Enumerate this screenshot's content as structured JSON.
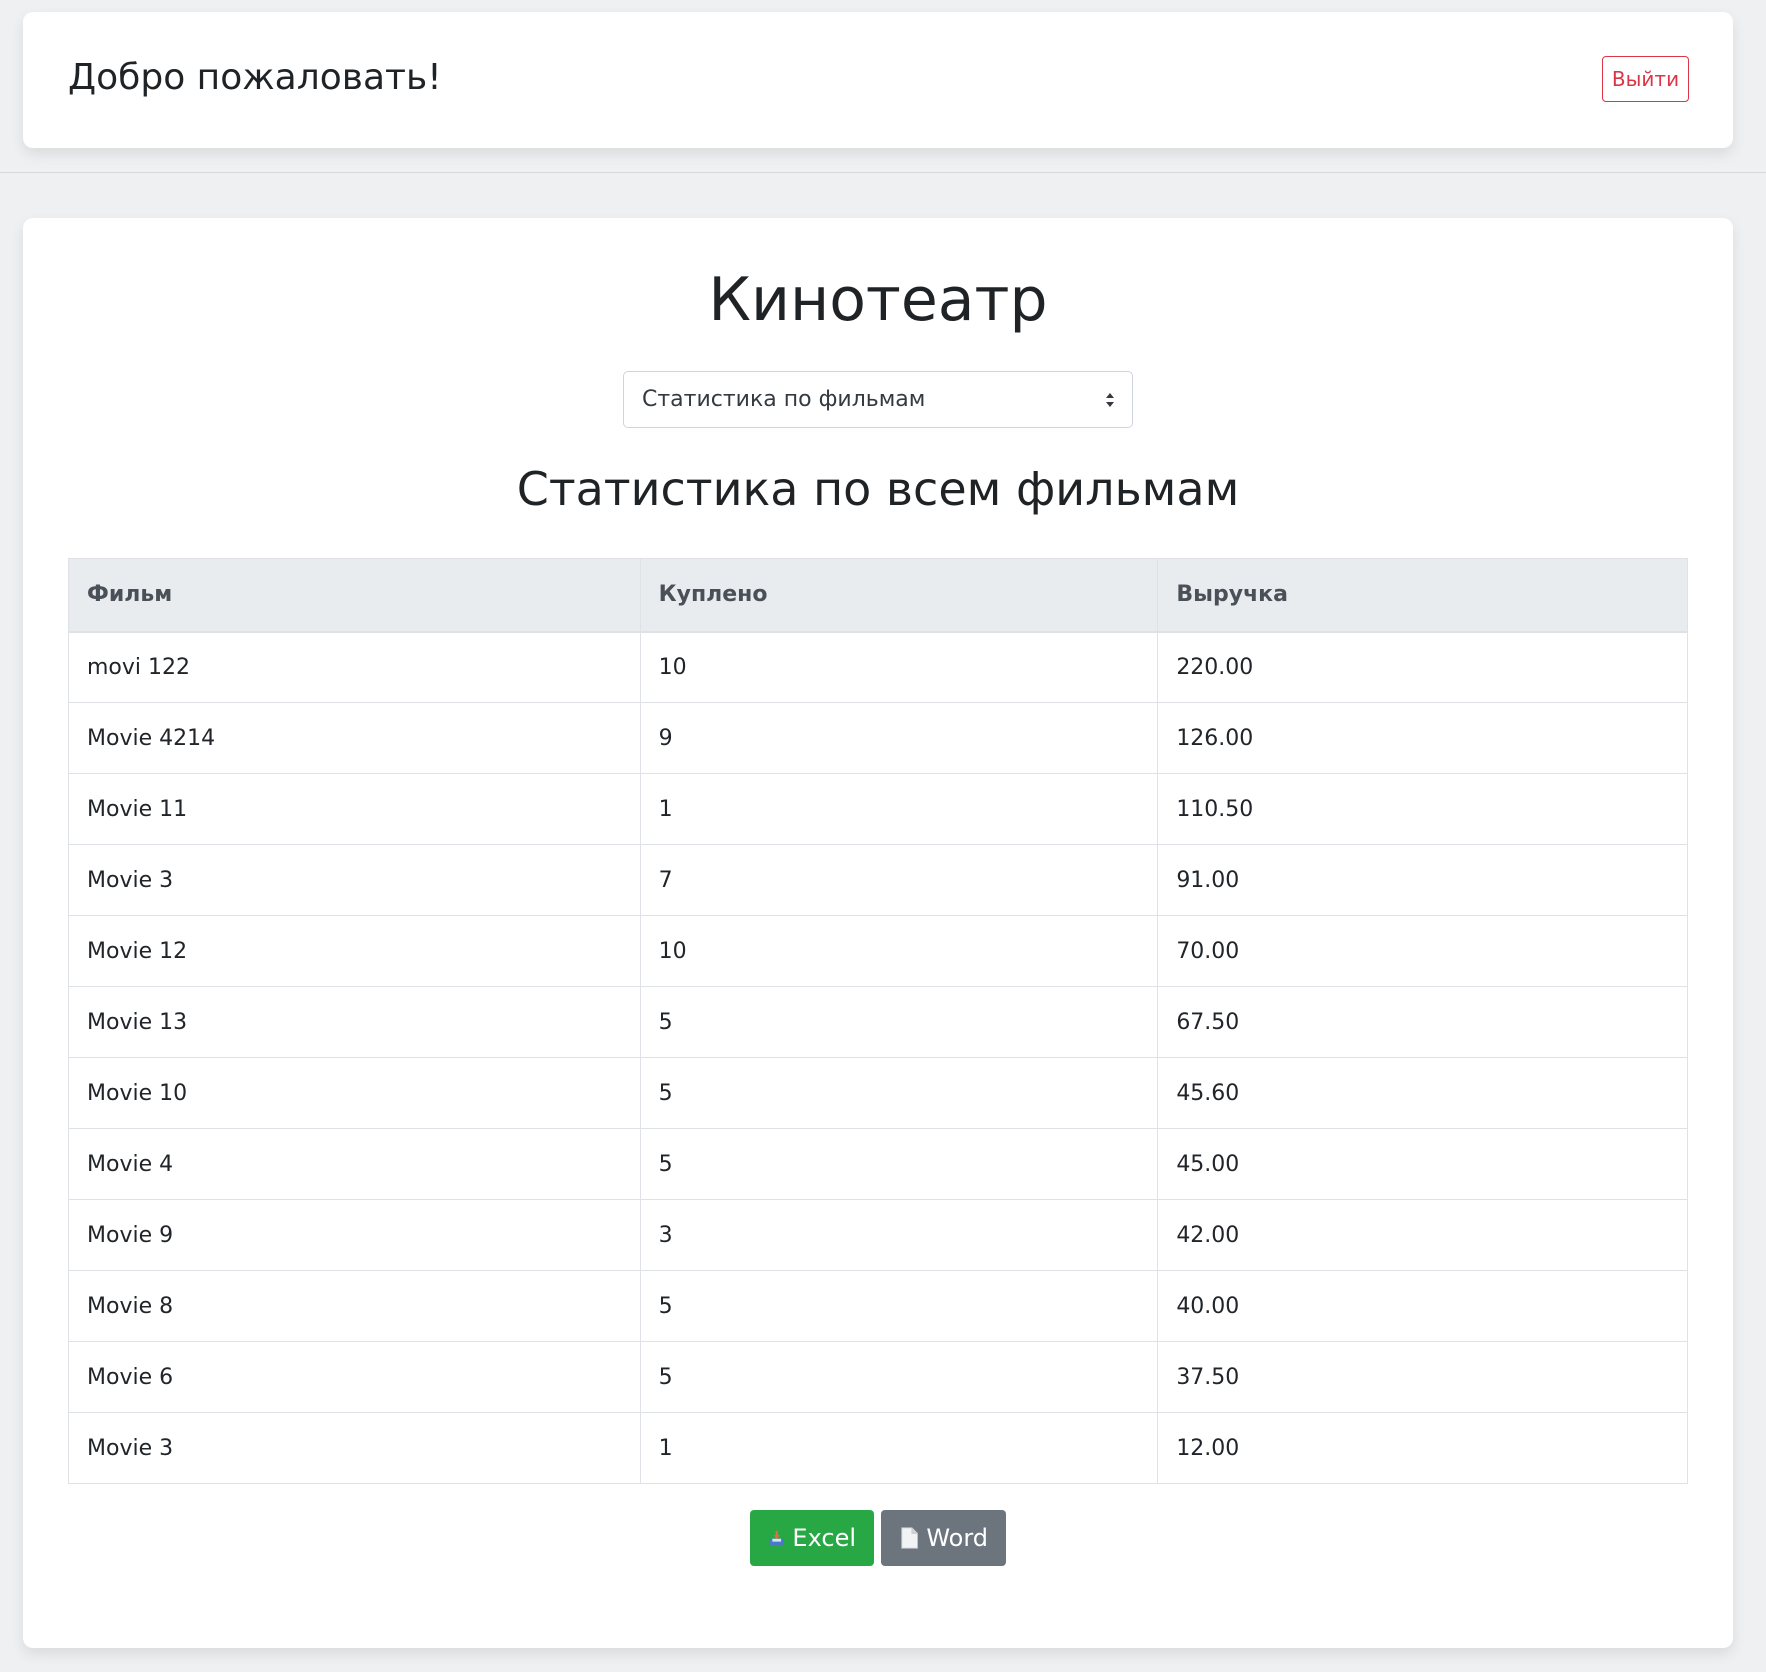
{
  "header": {
    "welcome": "Добро пожаловать!",
    "logout_label": "Выйти"
  },
  "main": {
    "title": "Кинотеатр",
    "select": {
      "selected": "Статистика по фильмам",
      "icon": "select-arrows-icon"
    },
    "section_title": "Статистика по всем фильмам",
    "table": {
      "columns": [
        "Фильм",
        "Куплено",
        "Выручка"
      ],
      "rows": [
        [
          "movi 122",
          "10",
          "220.00"
        ],
        [
          "Movie 4214",
          "9",
          "126.00"
        ],
        [
          "Movie 11",
          "1",
          "110.50"
        ],
        [
          "Movie 3",
          "7",
          "91.00"
        ],
        [
          "Movie 12",
          "10",
          "70.00"
        ],
        [
          "Movie 13",
          "5",
          "67.50"
        ],
        [
          "Movie 10",
          "5",
          "45.60"
        ],
        [
          "Movie 4",
          "5",
          "45.00"
        ],
        [
          "Movie 9",
          "3",
          "42.00"
        ],
        [
          "Movie 8",
          "5",
          "40.00"
        ],
        [
          "Movie 6",
          "5",
          "37.50"
        ],
        [
          "Movie 3",
          "1",
          "12.00"
        ]
      ]
    },
    "export": {
      "excel_label": "Excel",
      "excel_icon": "inbox-tray-icon",
      "word_label": "Word",
      "word_icon": "document-icon"
    }
  },
  "colors": {
    "danger": "#dc3545",
    "success": "#28a745",
    "secondary": "#6c757d",
    "table_header_bg": "#e9ecef",
    "page_bg": "#eef0f2"
  }
}
